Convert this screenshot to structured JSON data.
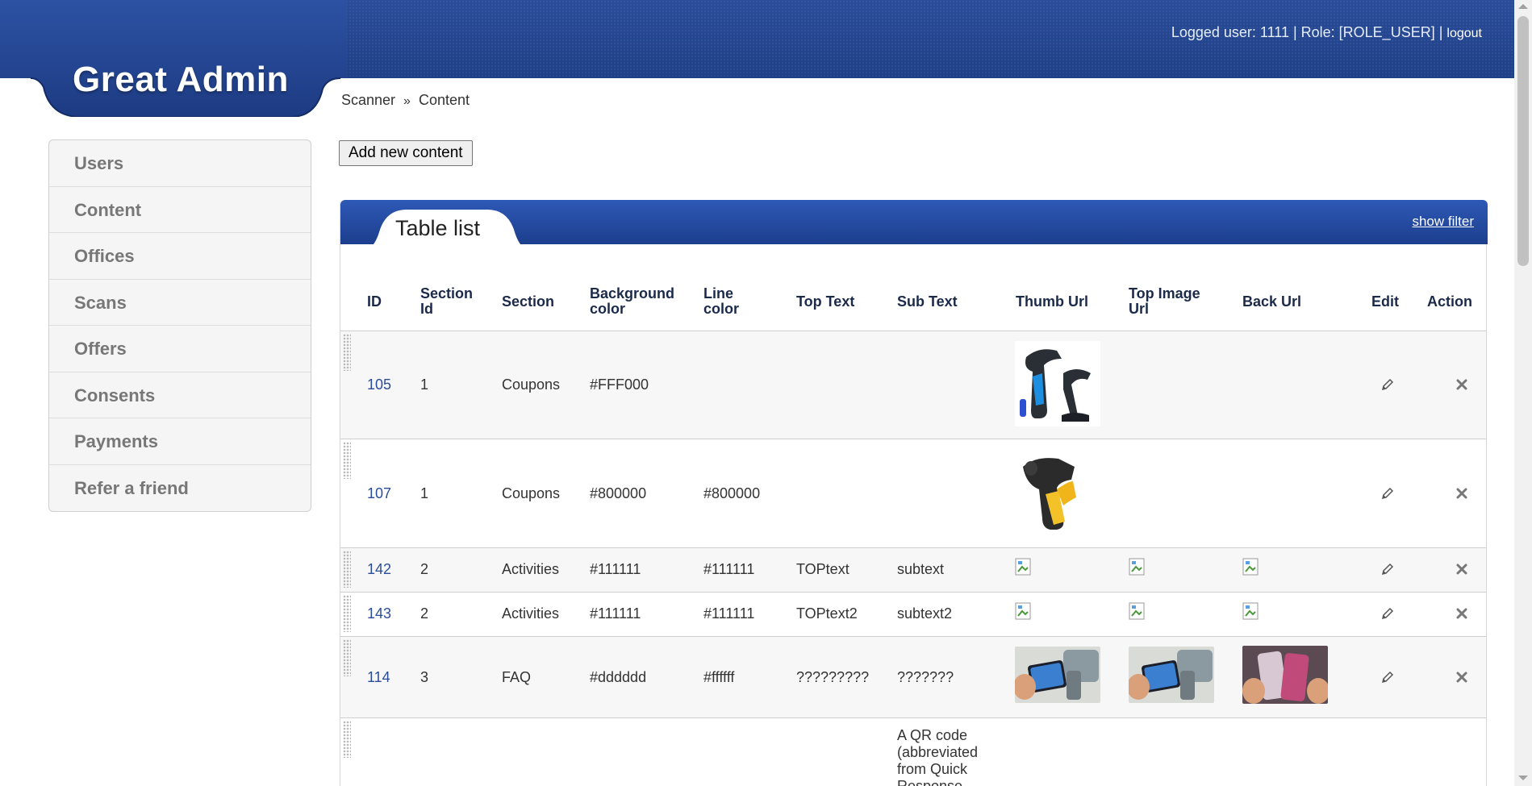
{
  "header": {
    "logo": "Great Admin",
    "user_info": "Logged user: 1111 | Role: [ROLE_USER] |",
    "logout": "logout",
    "colors": {
      "primary": "#1f3f86",
      "accent": "#2a4d9a"
    }
  },
  "breadcrumb": {
    "items": [
      "Scanner",
      "Content"
    ],
    "separator": "»"
  },
  "sidebar": {
    "items": [
      {
        "label": "Users"
      },
      {
        "label": "Content"
      },
      {
        "label": "Offices"
      },
      {
        "label": "Scans"
      },
      {
        "label": "Offers"
      },
      {
        "label": "Consents"
      },
      {
        "label": "Payments"
      },
      {
        "label": "Refer a friend"
      }
    ]
  },
  "toolbar": {
    "add_label": "Add new content"
  },
  "panel": {
    "title": "Table list",
    "show_filter": "show filter"
  },
  "table": {
    "columns": [
      "ID",
      "Section Id",
      "Section",
      "Background color",
      "Line color",
      "Top Text",
      "Sub Text",
      "Thumb Url",
      "Top Image Url",
      "Back Url",
      "Edit",
      "Action"
    ],
    "rows": [
      {
        "id": "105",
        "section_id": "1",
        "section": "Coupons",
        "bg_color": "#FFF000",
        "line_color": "",
        "top_text": "",
        "sub_text": "",
        "thumb": "scanner-image",
        "top_image": "",
        "back": ""
      },
      {
        "id": "107",
        "section_id": "1",
        "section": "Coupons",
        "bg_color": "#800000",
        "line_color": "#800000",
        "top_text": "",
        "sub_text": "",
        "thumb": "scanner-image",
        "top_image": "",
        "back": ""
      },
      {
        "id": "142",
        "section_id": "2",
        "section": "Activities",
        "bg_color": "#111111",
        "line_color": "#111111",
        "top_text": "TOPtext",
        "sub_text": "subtext",
        "thumb": "broken-image",
        "top_image": "broken-image",
        "back": "broken-image"
      },
      {
        "id": "143",
        "section_id": "2",
        "section": "Activities",
        "bg_color": "#111111",
        "line_color": "#111111",
        "top_text": "TOPtext2",
        "sub_text": "subtext2",
        "thumb": "broken-image",
        "top_image": "broken-image",
        "back": "broken-image"
      },
      {
        "id": "114",
        "section_id": "3",
        "section": "FAQ",
        "bg_color": "#dddddd",
        "line_color": "#ffffff",
        "top_text": "?????????",
        "sub_text": "???????",
        "thumb": "phone-photo",
        "top_image": "phone-photo",
        "back": "phone-photo"
      },
      {
        "id": "",
        "section_id": "",
        "section": "",
        "bg_color": "",
        "line_color": "",
        "top_text": "",
        "sub_text": "A QR code (abbreviated from Quick Response",
        "thumb": "",
        "top_image": "",
        "back": ""
      }
    ]
  }
}
